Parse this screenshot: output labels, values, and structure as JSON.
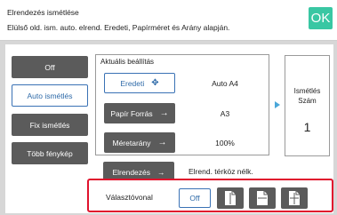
{
  "header": {
    "title": "Elrendezés ismétlése",
    "subtitle": "Elülső old. ism. auto. elrend. Eredeti, Papírméret és Arány alapján.",
    "ok_label": "OK"
  },
  "sidebar": {
    "items": [
      {
        "label": "Off",
        "active": false
      },
      {
        "label": "Auto ismétlés",
        "active": true
      },
      {
        "label": "Fix ismétlés",
        "active": false
      },
      {
        "label": "Több fénykép",
        "active": false
      }
    ]
  },
  "settings": {
    "title": "Aktuális beállítás",
    "rows": [
      {
        "label": "Eredeti",
        "value": "Auto  A4"
      },
      {
        "label": "Papír Forrás",
        "value": "A3"
      },
      {
        "label": "Méretarány",
        "value": "100%"
      }
    ]
  },
  "repeat": {
    "label": "Ismétlés Szám",
    "count": "1"
  },
  "order": {
    "label": "Elrendezés",
    "value": "Elrend. térköz nélk."
  },
  "separator": {
    "label": "Választóvonal",
    "off_label": "Off",
    "options": [
      "page-line-icon-1",
      "page-line-icon-2",
      "page-line-icon-3"
    ]
  },
  "colors": {
    "accent": "#39c7a3",
    "active_border": "#3a72b5",
    "highlight": "#e0122d"
  }
}
